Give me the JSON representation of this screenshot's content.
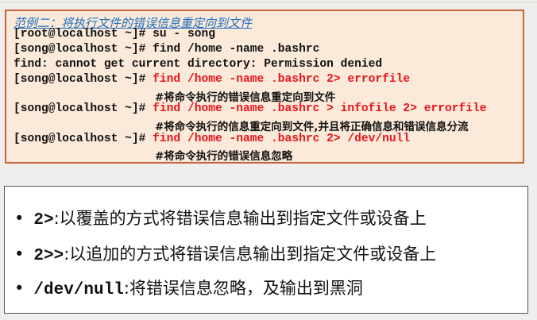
{
  "example": {
    "title": "范例二：将执行文件的错误信息重定向到文件",
    "lines": [
      {
        "prompt": "[root@localhost ~]# ",
        "command": "su - song",
        "highlight": false
      },
      {
        "prompt": "[song@localhost ~]# ",
        "command": "find /home -name .bashrc",
        "highlight": false
      },
      {
        "prompt": "",
        "command": "find: cannot get current directory: Permission denied",
        "highlight": false
      },
      {
        "prompt": "[song@localhost ~]# ",
        "command": "find /home -name .bashrc 2> errorfile",
        "highlight": true,
        "comment": "#将命令执行的错误信息重定向到文件"
      },
      {
        "prompt": "[song@localhost ~]# ",
        "command": "find /home -name .bashrc > infofile 2> errorfile",
        "highlight": true,
        "comment": "#将命令执行的信息重定向到文件,并且将正确信息和错误信息分流"
      },
      {
        "prompt": "[song@localhost ~]# ",
        "command": "find /home -name .bashrc 2> /dev/null",
        "highlight": true,
        "comment": "#将命令执行的错误信息忽略"
      }
    ]
  },
  "notes": [
    {
      "bullet": "•",
      "code": "2>",
      "text": ":以覆盖的方式将错误信息输出到指定文件或设备上"
    },
    {
      "bullet": "•",
      "code": "2>>",
      "text": ":以追加的方式将错误信息输出到指定文件或设备上"
    },
    {
      "bullet": "•",
      "code": "/dev/null",
      "text": ":将错误信息忽略，及输出到黑洞"
    }
  ],
  "colors": {
    "command_highlight": "#e8141a",
    "title": "#1f6fc0",
    "box_border": "#c9653a",
    "box_bg": "#fbe9da"
  }
}
